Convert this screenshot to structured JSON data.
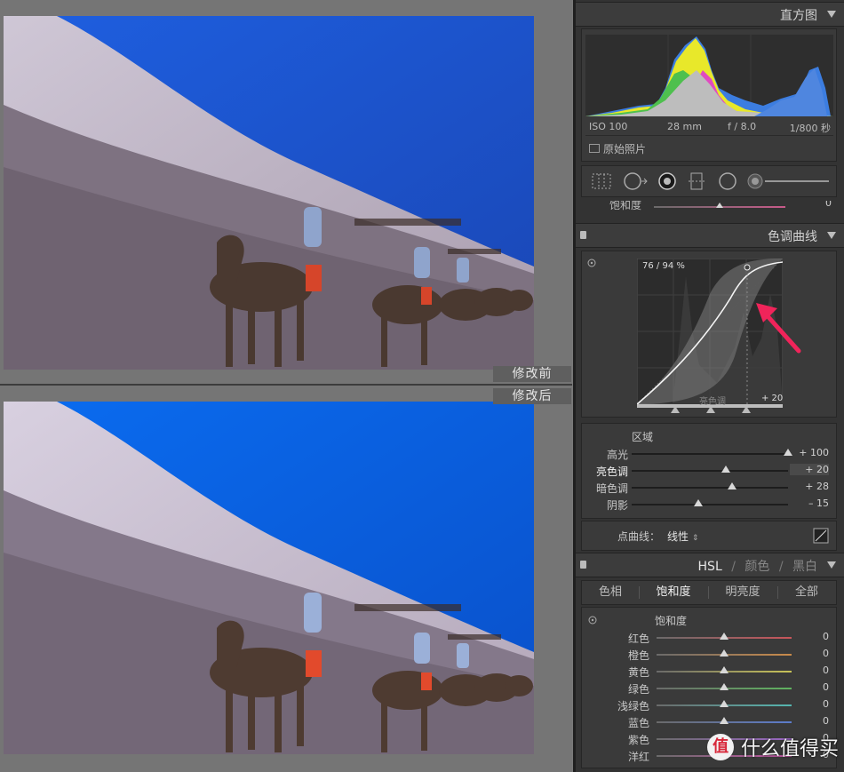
{
  "photos": {
    "before_label": "修改前",
    "after_label": "修改后"
  },
  "histogram": {
    "title": "直方图",
    "iso": "ISO 100",
    "focal": "28 mm",
    "aperture": "f / 8.0",
    "shutter": "1/800 秒",
    "original_label": "原始照片",
    "clip_shadow_color": "#e03030",
    "clip_highlight_color": "#111111"
  },
  "saturation_remnant": {
    "label": "饱和度",
    "value": "0"
  },
  "tone_curve": {
    "title": "色调曲线",
    "readout": "76 / 94 %",
    "region_hint": "亮色调",
    "region_value": "+ 20",
    "region_title": "区域",
    "sliders": [
      {
        "label": "高光",
        "value": "+ 100",
        "level": 1.0
      },
      {
        "label": "亮色调",
        "value": "+ 20",
        "level": 0.6
      },
      {
        "label": "暗色调",
        "value": "+ 28",
        "level": 0.64
      },
      {
        "label": "阴影",
        "value": "– 15",
        "level": 0.425
      }
    ],
    "point_curve_label": "点曲线：",
    "point_curve_value": "线性",
    "annotation_arrow_color": "#f0245a"
  },
  "hsl": {
    "title": "HSL",
    "color_label": "颜色",
    "bw_label": "黑白",
    "separator": "/",
    "tabs": [
      "色相",
      "饱和度",
      "明亮度",
      "全部"
    ],
    "active_tab": "饱和度",
    "section_title": "饱和度",
    "sliders": [
      {
        "label": "红色",
        "value": "0",
        "level": 0.5,
        "color": "#c8555a"
      },
      {
        "label": "橙色",
        "value": "0",
        "level": 0.5,
        "color": "#c98a4a"
      },
      {
        "label": "黄色",
        "value": "0",
        "level": 0.5,
        "color": "#c8c257"
      },
      {
        "label": "绿色",
        "value": "0",
        "level": 0.5,
        "color": "#5fb25f"
      },
      {
        "label": "浅绿色",
        "value": "0",
        "level": 0.5,
        "color": "#55b6b0"
      },
      {
        "label": "蓝色",
        "value": "0",
        "level": 0.5,
        "color": "#5c7ccc"
      },
      {
        "label": "紫色",
        "value": "0",
        "level": 0.5,
        "color": "#9a66c4"
      },
      {
        "label": "洋红",
        "value": "0",
        "level": 0.5,
        "color": "#c456a6"
      }
    ]
  },
  "watermark": {
    "text": "什么值得买",
    "badge": "值"
  }
}
